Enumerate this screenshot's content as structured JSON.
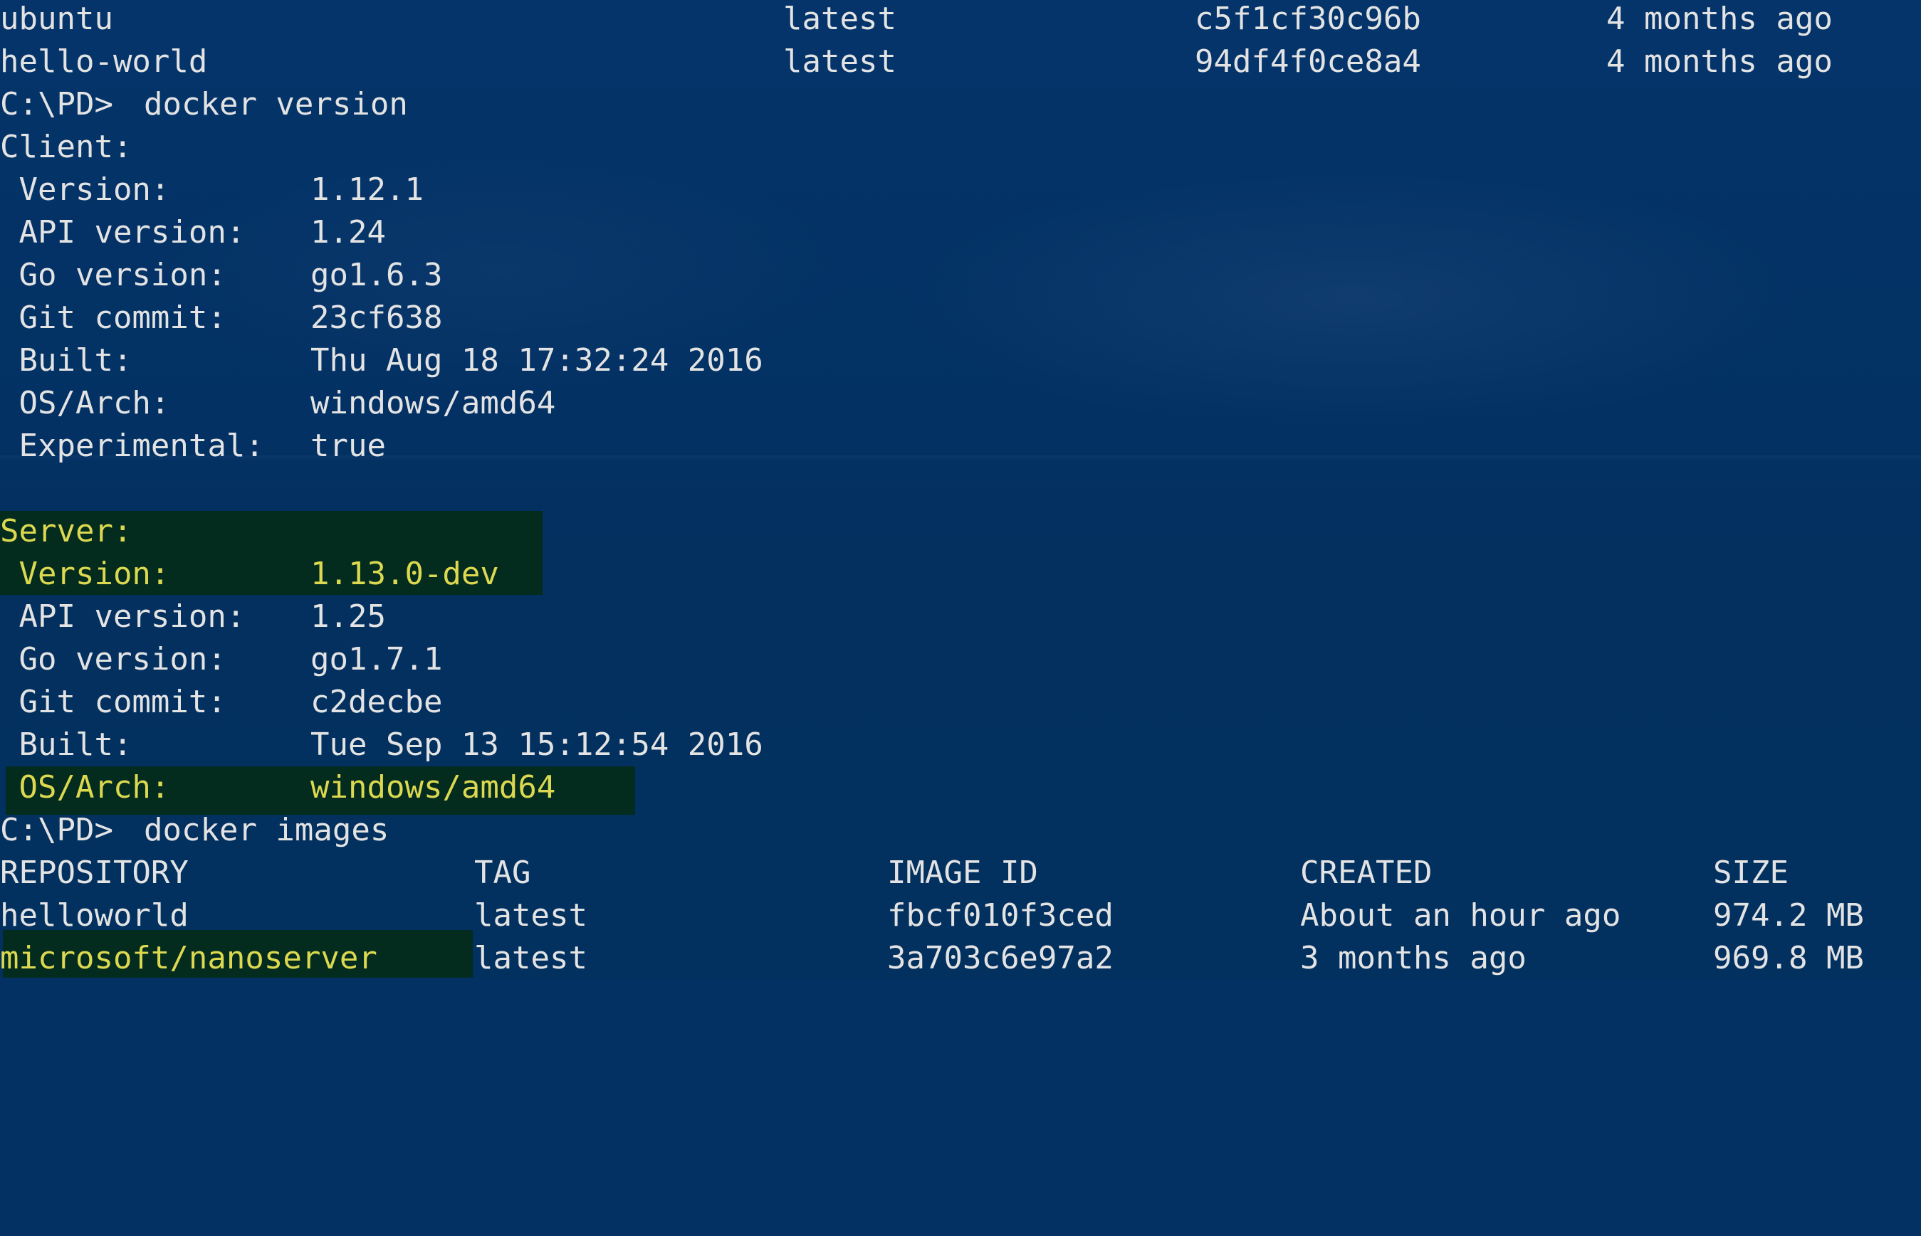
{
  "theme": {
    "background": "#033163",
    "text": "#e3e3e3",
    "highlight_bg": "#032c1f",
    "highlight_text": "#dcd84f"
  },
  "prev_images": [
    {
      "repository": "ubuntu",
      "tag": "latest",
      "image_id": "c5f1cf30c96b",
      "created": "4 months ago"
    },
    {
      "repository": "hello-world",
      "tag": "latest",
      "image_id": "94df4f0ce8a4",
      "created": "4 months ago"
    }
  ],
  "cmd_version": {
    "prompt": "C:\\PD>",
    "command": "docker version"
  },
  "client": {
    "header": "Client:",
    "fields": [
      {
        "label": " Version:",
        "value": "1.12.1"
      },
      {
        "label": " API version:",
        "value": "1.24"
      },
      {
        "label": " Go version:",
        "value": "go1.6.3"
      },
      {
        "label": " Git commit:",
        "value": "23cf638"
      },
      {
        "label": " Built:",
        "value": "Thu Aug 18 17:32:24 2016"
      },
      {
        "label": " OS/Arch:",
        "value": "windows/amd64"
      },
      {
        "label": " Experimental:",
        "value": "true"
      }
    ]
  },
  "server": {
    "header": "Server:",
    "fields": [
      {
        "label": " Version:",
        "value": "1.13.0-dev"
      },
      {
        "label": " API version:",
        "value": "1.25"
      },
      {
        "label": " Go version:",
        "value": "go1.7.1"
      },
      {
        "label": " Git commit:",
        "value": "c2decbe"
      },
      {
        "label": " Built:",
        "value": "Tue Sep 13 15:12:54 2016"
      },
      {
        "label": " OS/Arch:",
        "value": "windows/amd64"
      }
    ]
  },
  "cmd_images": {
    "prompt": "C:\\PD>",
    "command": "docker images"
  },
  "images_table": {
    "headers": [
      "REPOSITORY",
      "TAG",
      "IMAGE ID",
      "CREATED",
      "SIZE"
    ],
    "rows": [
      {
        "repository": "helloworld",
        "tag": "latest",
        "image_id": "fbcf010f3ced",
        "created": "About an hour ago",
        "size": "974.2 MB"
      },
      {
        "repository": "microsoft/nanoserver",
        "tag": "latest",
        "image_id": "3a703c6e97a2",
        "created": "3 months ago",
        "size": "969.8 MB"
      }
    ]
  }
}
